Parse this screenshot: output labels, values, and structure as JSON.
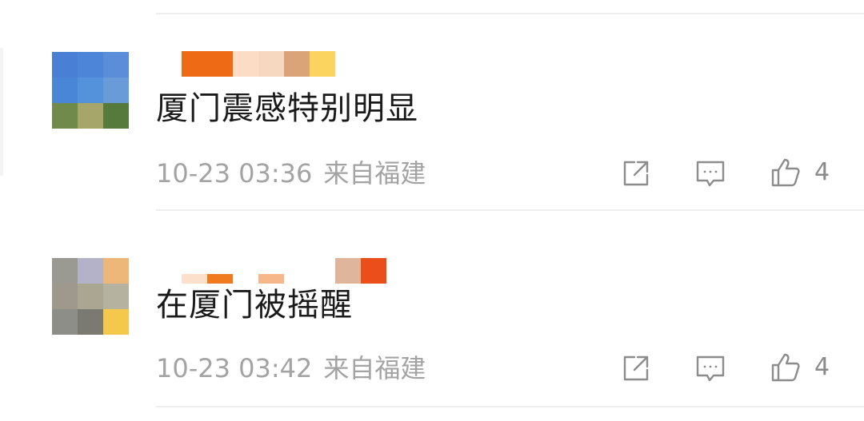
{
  "comments": [
    {
      "text": "厦门震感特别明显",
      "time": "10-23 03:36",
      "location": "来自福建",
      "likes": "4",
      "avatar_colors": [
        "#4a7fd6",
        "#4d85d8",
        "#5b8ed9",
        "#4a86d8",
        "#5592dc",
        "#6a9bd9",
        "#6f8a4a",
        "#a6a56a",
        "#557a3c"
      ],
      "name_colors": [
        "#ef6a14",
        "#fcdcc4",
        "#f6d8c0",
        "#dba478",
        "#fbd35f"
      ]
    },
    {
      "text": "在厦门被摇醒",
      "time": "10-23 03:42",
      "location": "来自福建",
      "likes": "4",
      "avatar_colors": [
        "#9a9a92",
        "#b4b2c8",
        "#eeb77a",
        "#9e998c",
        "#aaa692",
        "#b5b29f",
        "#8e8e88",
        "#7b7a72",
        "#f3c84b"
      ],
      "name_colors": [
        "#fde0cc",
        "#f07b1e",
        "#fcd8c0",
        "#f6b88a",
        "#dfb59c",
        "#ea4f19"
      ]
    }
  ],
  "icons": {
    "share": "share-icon",
    "comment": "comment-icon",
    "like": "thumbs-up-icon"
  }
}
